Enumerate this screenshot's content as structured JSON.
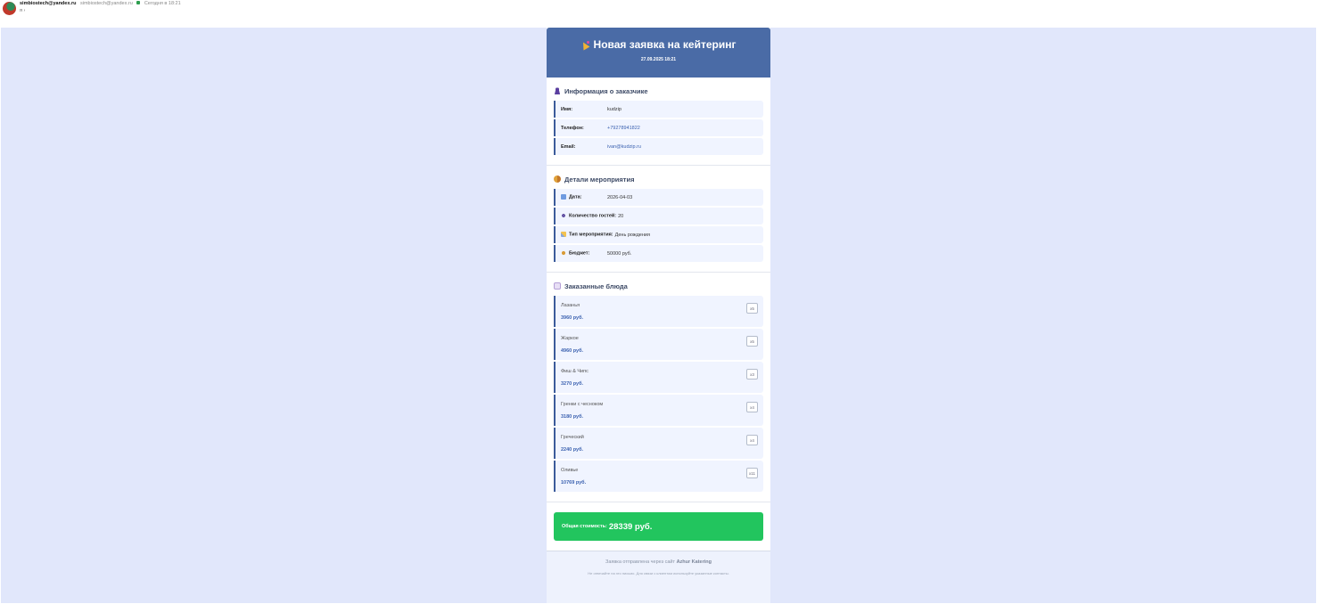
{
  "mail": {
    "sender_name": "simbiostech@yandex.ru",
    "sender_email": "simbiostech@yandex.ru",
    "time": "Сегодня в 18:21",
    "recipient": "я ›"
  },
  "email": {
    "title": "Новая заявка на кейтеринг",
    "date": "27.09.2025 18:21",
    "customer": {
      "title": "Информация о заказчике",
      "name_label": "Имя:",
      "name_value": "kudzip",
      "phone_label": "Телефон:",
      "phone_value": "+79278941822",
      "email_label": "Email:",
      "email_value": "ivan@kudzip.ru"
    },
    "event": {
      "title": "Детали мероприятия",
      "date_label": "Дата:",
      "date_value": "2026-04-03",
      "guests_label": "Количество гостей:",
      "guests_value": "20",
      "type_label": "Тип мероприятия:",
      "type_value": "День рождения",
      "budget_label": "Бюджет:",
      "budget_value": "50000 руб."
    },
    "dishes": {
      "title": "Заказанные блюда",
      "items": [
        {
          "name": "Лазанья",
          "price": "3960 руб.",
          "qty": "x5"
        },
        {
          "name": "Жаркое",
          "price": "4960 руб.",
          "qty": "x5"
        },
        {
          "name": "Фиш & Чипс",
          "price": "3270 руб.",
          "qty": "x3"
        },
        {
          "name": "Гренки с чесноком",
          "price": "3180 руб.",
          "qty": "x4"
        },
        {
          "name": "Греческий",
          "price": "2240 руб.",
          "qty": "x4"
        },
        {
          "name": "Оливье",
          "price": "10769 руб.",
          "qty": "x11"
        }
      ]
    },
    "total": {
      "label": "Общая стоимость:",
      "value": "28339 руб."
    },
    "footer": {
      "line1_prefix": "Заявка отправлена через сайт",
      "site_name": "Azhur Katering",
      "line2": "Не отвечайте на это письмо. Для связи с клиентом используйте указанные контакты."
    }
  }
}
